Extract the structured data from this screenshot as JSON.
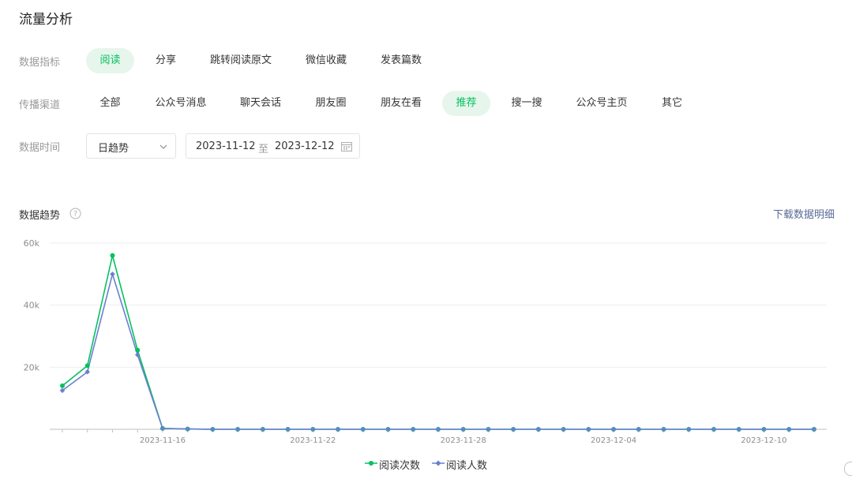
{
  "page": {
    "title": "流量分析"
  },
  "metrics": {
    "label": "数据指标",
    "options": [
      "阅读",
      "分享",
      "跳转阅读原文",
      "微信收藏",
      "发表篇数"
    ],
    "selected": "阅读"
  },
  "channels": {
    "label": "传播渠道",
    "options": [
      "全部",
      "公众号消息",
      "聊天会话",
      "朋友圈",
      "朋友在看",
      "推荐",
      "搜一搜",
      "公众号主页",
      "其它"
    ],
    "selected": "推荐"
  },
  "time": {
    "label": "数据时间",
    "granularity": "日趋势",
    "start": "2023-11-12",
    "separator": "至",
    "end": "2023-12-12"
  },
  "trend": {
    "title": "数据趋势",
    "download_label": "下载数据明细"
  },
  "colors": {
    "accent": "#07c160",
    "series_reads": "#07c160",
    "series_readers": "#6b7fd1",
    "link": "#576b95"
  },
  "icons": {
    "help": "question-circle-icon",
    "dropdown": "chevron-down-icon",
    "calendar": "calendar-icon"
  },
  "chart_data": {
    "type": "line",
    "title": "",
    "xlabel": "",
    "ylabel": "",
    "x": [
      "2023-11-12",
      "2023-11-13",
      "2023-11-14",
      "2023-11-15",
      "2023-11-16",
      "2023-11-17",
      "2023-11-18",
      "2023-11-19",
      "2023-11-20",
      "2023-11-21",
      "2023-11-22",
      "2023-11-23",
      "2023-11-24",
      "2023-11-25",
      "2023-11-26",
      "2023-11-27",
      "2023-11-28",
      "2023-11-29",
      "2023-11-30",
      "2023-12-01",
      "2023-12-02",
      "2023-12-03",
      "2023-12-04",
      "2023-12-05",
      "2023-12-06",
      "2023-12-07",
      "2023-12-08",
      "2023-12-09",
      "2023-12-10",
      "2023-12-11",
      "2023-12-12"
    ],
    "x_tick_labels": [
      "2023-11-16",
      "2023-11-22",
      "2023-11-28",
      "2023-12-04",
      "2023-12-10"
    ],
    "y_ticks": [
      "20k",
      "40k",
      "60k"
    ],
    "ylim": [
      0,
      60000
    ],
    "grid": true,
    "legend": "bottom-center",
    "series": [
      {
        "name": "阅读次数",
        "values": [
          14000,
          20500,
          56000,
          25500,
          300,
          100,
          0,
          0,
          0,
          0,
          0,
          0,
          0,
          0,
          0,
          0,
          0,
          0,
          0,
          0,
          0,
          0,
          0,
          0,
          0,
          0,
          0,
          0,
          0,
          0,
          0
        ]
      },
      {
        "name": "阅读人数",
        "values": [
          12500,
          18500,
          50000,
          24000,
          250,
          100,
          0,
          0,
          0,
          0,
          0,
          0,
          0,
          0,
          0,
          0,
          0,
          0,
          0,
          0,
          0,
          0,
          0,
          0,
          0,
          0,
          0,
          0,
          0,
          0,
          0
        ]
      }
    ]
  }
}
